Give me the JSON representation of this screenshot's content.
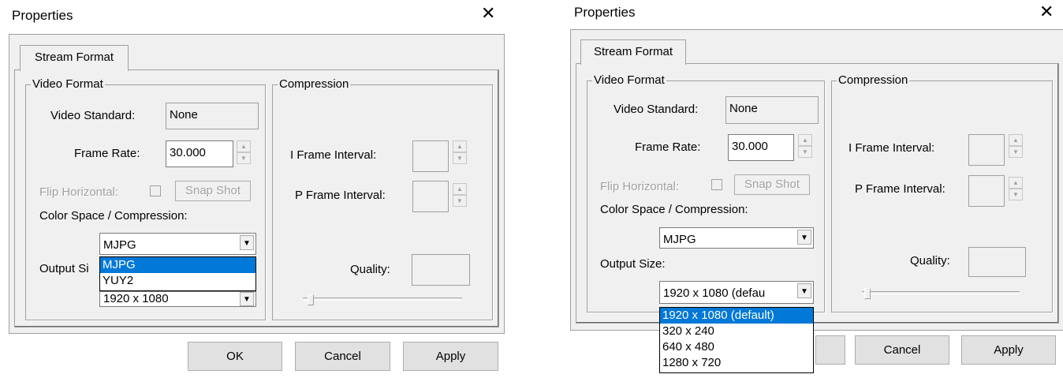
{
  "dialog1": {
    "title": "Properties",
    "close_glyph": "✕",
    "tab": "Stream Format",
    "video_group": "Video Format",
    "compression_group": "Compression",
    "video_standard_label": "Video Standard:",
    "video_standard_value": "None",
    "frame_rate_label": "Frame Rate:",
    "frame_rate_value": "30.000",
    "flip_label": "Flip Horizontal:",
    "snapshot_label": "Snap Shot",
    "color_space_label": "Color Space / Compression:",
    "color_space_value": "MJPG",
    "color_space_options": [
      "MJPG",
      "YUY2"
    ],
    "output_size_label": "Output Si",
    "output_size_value": "1920 x 1080",
    "i_frame_label": "I Frame Interval:",
    "p_frame_label": "P Frame Interval:",
    "quality_label": "Quality:",
    "ok_label": "OK",
    "cancel_label": "Cancel",
    "apply_label": "Apply"
  },
  "dialog2": {
    "title": "Properties",
    "close_glyph": "✕",
    "tab": "Stream Format",
    "video_group": "Video Format",
    "compression_group": "Compression",
    "video_standard_label": "Video Standard:",
    "video_standard_value": "None",
    "frame_rate_label": "Frame Rate:",
    "frame_rate_value": "30.000",
    "flip_label": "Flip Horizontal:",
    "snapshot_label": "Snap Shot",
    "color_space_label": "Color Space / Compression:",
    "color_space_value": "MJPG",
    "output_size_label": "Output Size:",
    "output_size_value": "1920 x 1080  (defau",
    "output_size_options": [
      "1920 x 1080  (default)",
      "320 x 240",
      "640 x 480",
      "1280 x 720"
    ],
    "i_frame_label": "I Frame Interval:",
    "p_frame_label": "P Frame Interval:",
    "quality_label": "Quality:",
    "cancel_label": "Cancel",
    "apply_label": "Apply"
  },
  "icons": {
    "close": "close-icon",
    "spin_up": "▲",
    "spin_down": "▼",
    "dropdown": "▼"
  },
  "colors": {
    "dialog_bg": "#f0f0f0",
    "selection": "#0078d7",
    "border": "#a0a0a0"
  }
}
